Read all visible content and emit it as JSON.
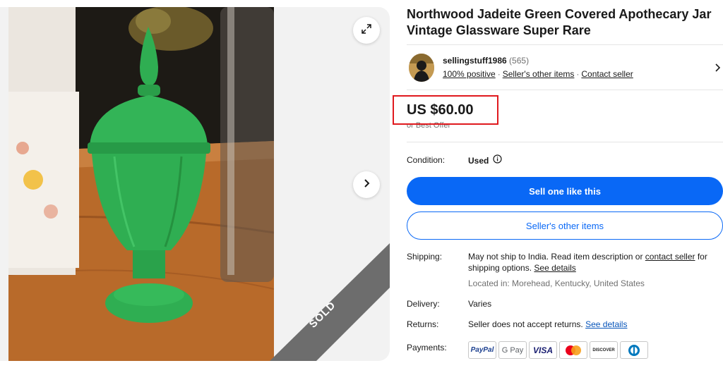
{
  "listing": {
    "title": "Northwood Jadeite Green Covered Apothecary Jar Vintage Glassware Super Rare",
    "sold_label": "SOLD"
  },
  "seller": {
    "name": "sellingstuff1986",
    "feedback_count": "(565)",
    "positive": "100% positive",
    "other_items": "Seller's other items",
    "contact": "Contact seller",
    "separator": "·"
  },
  "price": {
    "amount": "US $60.00",
    "best_offer": "or Best Offer"
  },
  "condition": {
    "label": "Condition:",
    "value": "Used"
  },
  "buttons": {
    "sell_like_this": "Sell one like this",
    "sellers_other_items": "Seller's other items"
  },
  "shipping": {
    "label": "Shipping:",
    "text_before": "May not ship to India. Read item description or ",
    "contact_link": "contact seller",
    "text_after": " for shipping options. ",
    "details_link": "See details",
    "location": "Located in: Morehead, Kentucky, United States"
  },
  "delivery": {
    "label": "Delivery:",
    "value": "Varies"
  },
  "returns": {
    "label": "Returns:",
    "text": "Seller does not accept returns. ",
    "details_link": "See details"
  },
  "payments": {
    "label": "Payments:",
    "methods": [
      "PayPal",
      "G Pay",
      "VISA",
      "Mastercard",
      "DISCOVER",
      "Diners Club"
    ]
  },
  "colors": {
    "primary_blue": "#0968f6",
    "highlight_red": "#e0191e",
    "jar_green": "#2fae52"
  },
  "icons": [
    "expand-icon",
    "chevron-right-icon",
    "info-icon",
    "chevron-right-icon"
  ]
}
